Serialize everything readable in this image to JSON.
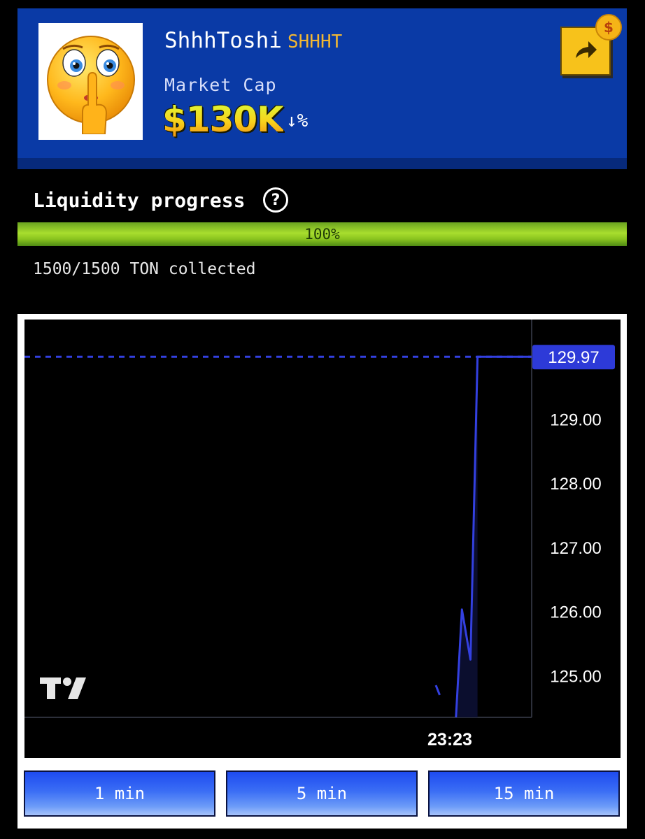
{
  "token": {
    "name": "ShhhToshi",
    "symbol": "SHHHT",
    "market_cap_label": "Market Cap",
    "market_cap_value": "$130K",
    "change_arrow": "↓",
    "change_text": "%"
  },
  "icons": {
    "avatar": "shushing-face-emoji",
    "share": "share-arrow-icon",
    "coin": "dollar-coin-icon",
    "help": "question-circle-icon",
    "watermark": "tradingview-logo-icon"
  },
  "share_coin_symbol": "$",
  "liquidity": {
    "title": "Liquidity progress",
    "help_symbol": "?",
    "progress_fraction": 1.0,
    "progress_label": "100%",
    "collected_text": "1500/1500 TON collected"
  },
  "timeframes": [
    {
      "label": "1 min"
    },
    {
      "label": "5 min"
    },
    {
      "label": "15 min"
    }
  ],
  "colors": {
    "header_bg": "#0a3aa6",
    "line": "#3340e0",
    "last_price_bg": "#2d3ad8"
  },
  "chart_data": {
    "type": "line",
    "y_ticks": [
      "129.00",
      "128.00",
      "127.00",
      "126.00",
      "125.00"
    ],
    "ylim": [
      124.35,
      130.55
    ],
    "x_tick": "23:23",
    "last_price": "129.97",
    "last_price_value": 129.97,
    "series": [
      {
        "segments": [
          [
            {
              "t": 0.0,
              "v": 124.85
            },
            {
              "t": 0.04,
              "v": 124.7
            }
          ],
          [
            {
              "t": 0.21,
              "v": 124.35
            },
            {
              "t": 0.272,
              "v": 126.03
            },
            {
              "t": 0.361,
              "v": 125.25
            },
            {
              "t": 0.435,
              "v": 129.97
            },
            {
              "t": 1.0,
              "v": 129.97
            }
          ]
        ]
      }
    ],
    "grid": false
  }
}
